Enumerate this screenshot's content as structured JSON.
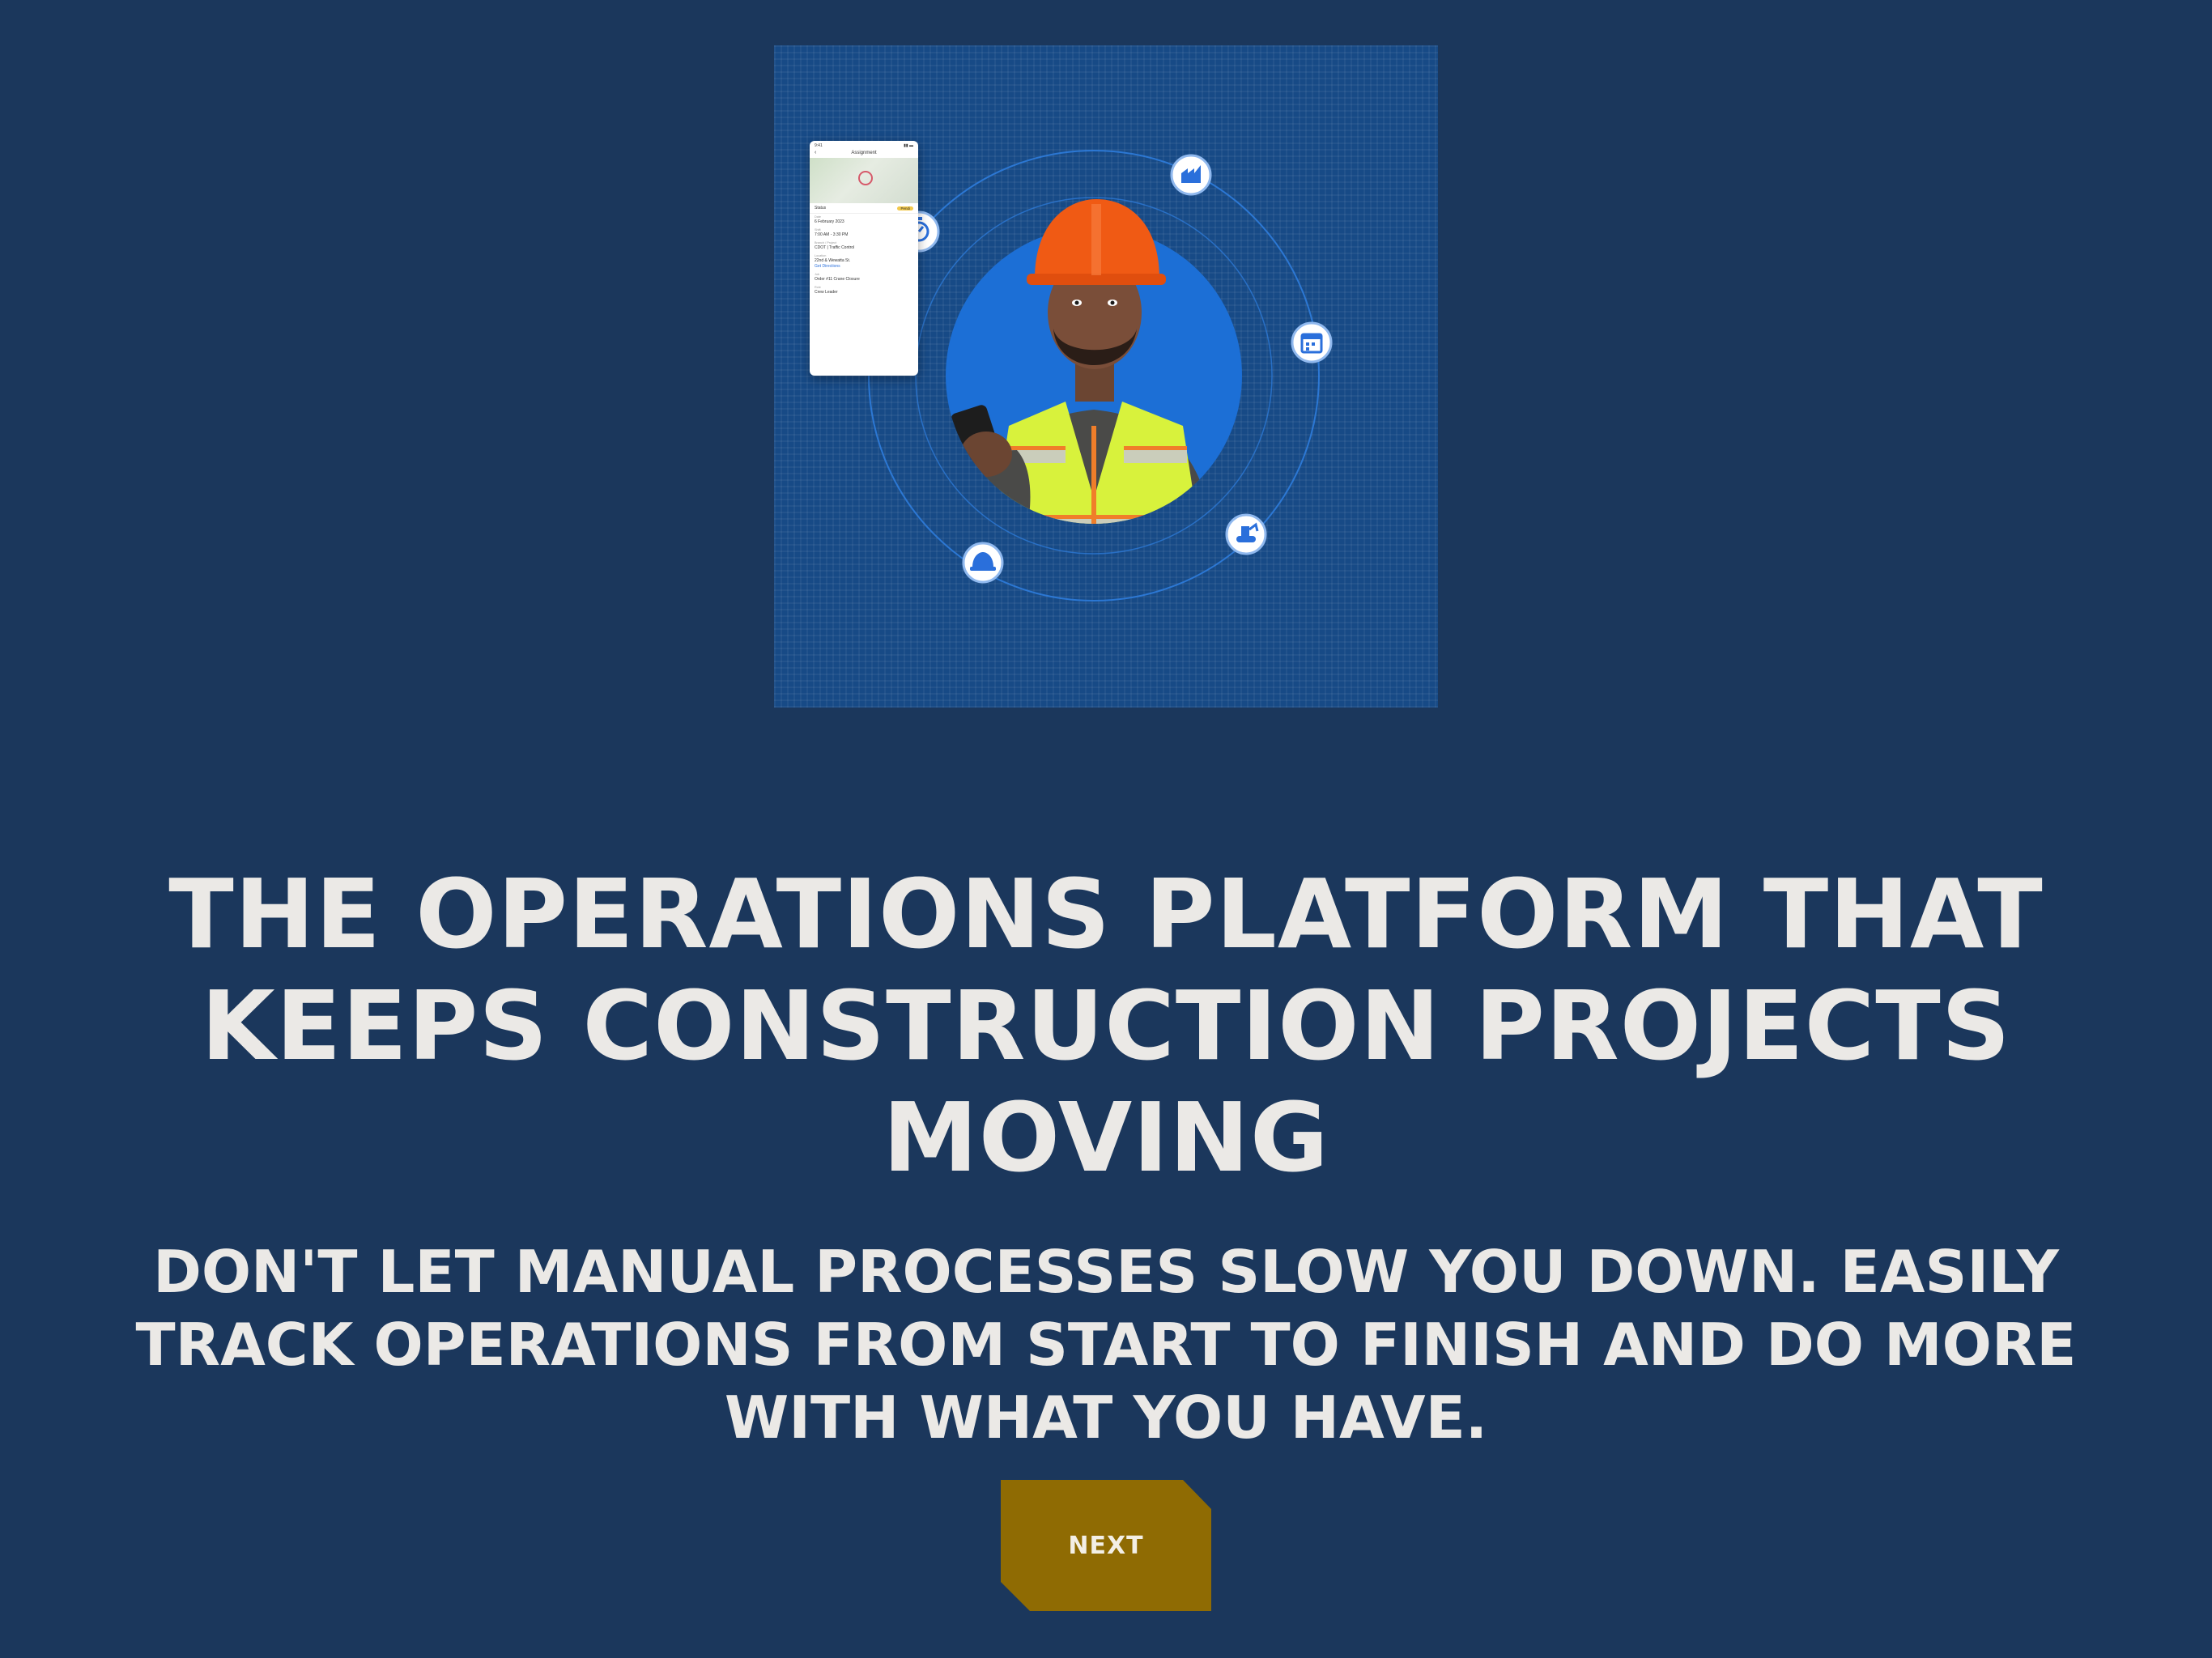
{
  "hero": {
    "phone": {
      "status_time": "9:41",
      "header_title": "Assignment",
      "status_label": "Status",
      "status_badge": "Pendi",
      "fields": [
        {
          "label": "Date",
          "value": "6 February 2023"
        },
        {
          "label": "Shift",
          "value": "7:00 AM - 3:30 PM"
        },
        {
          "label": "Branch / Project",
          "value": "CDOT | Traffic Control"
        },
        {
          "label": "Location",
          "value": "22nd & Wewatta St."
        },
        {
          "label": "",
          "value": "Get Directions",
          "link": true
        },
        {
          "label": "Job",
          "value": "Order #11 Crane Closure"
        },
        {
          "label": "Role",
          "value": "Crew Leader"
        }
      ]
    },
    "orbit_icons": [
      "timer-icon",
      "factory-icon",
      "calendar-icon",
      "excavator-icon",
      "hard-hat-icon"
    ],
    "colors": {
      "grid_bg": "#174a86",
      "circle": "#1c6fd6",
      "orbit": "#2f7fe0",
      "vest": "#d8f23c",
      "helmet": "#f05a14"
    }
  },
  "headline": "THE OPERATIONS PLATFORM THAT KEEPS CONSTRUCTION PROJECTS MOVING",
  "subheadline": "DON'T LET MANUAL PROCESSES SLOW YOU DOWN. EASILY TRACK OPERATIONS FROM START TO FINISH AND DO MORE WITH WHAT YOU HAVE.",
  "next_button": {
    "label": "NEXT",
    "color": "#8f6b03"
  },
  "page_background": "#1b375c"
}
